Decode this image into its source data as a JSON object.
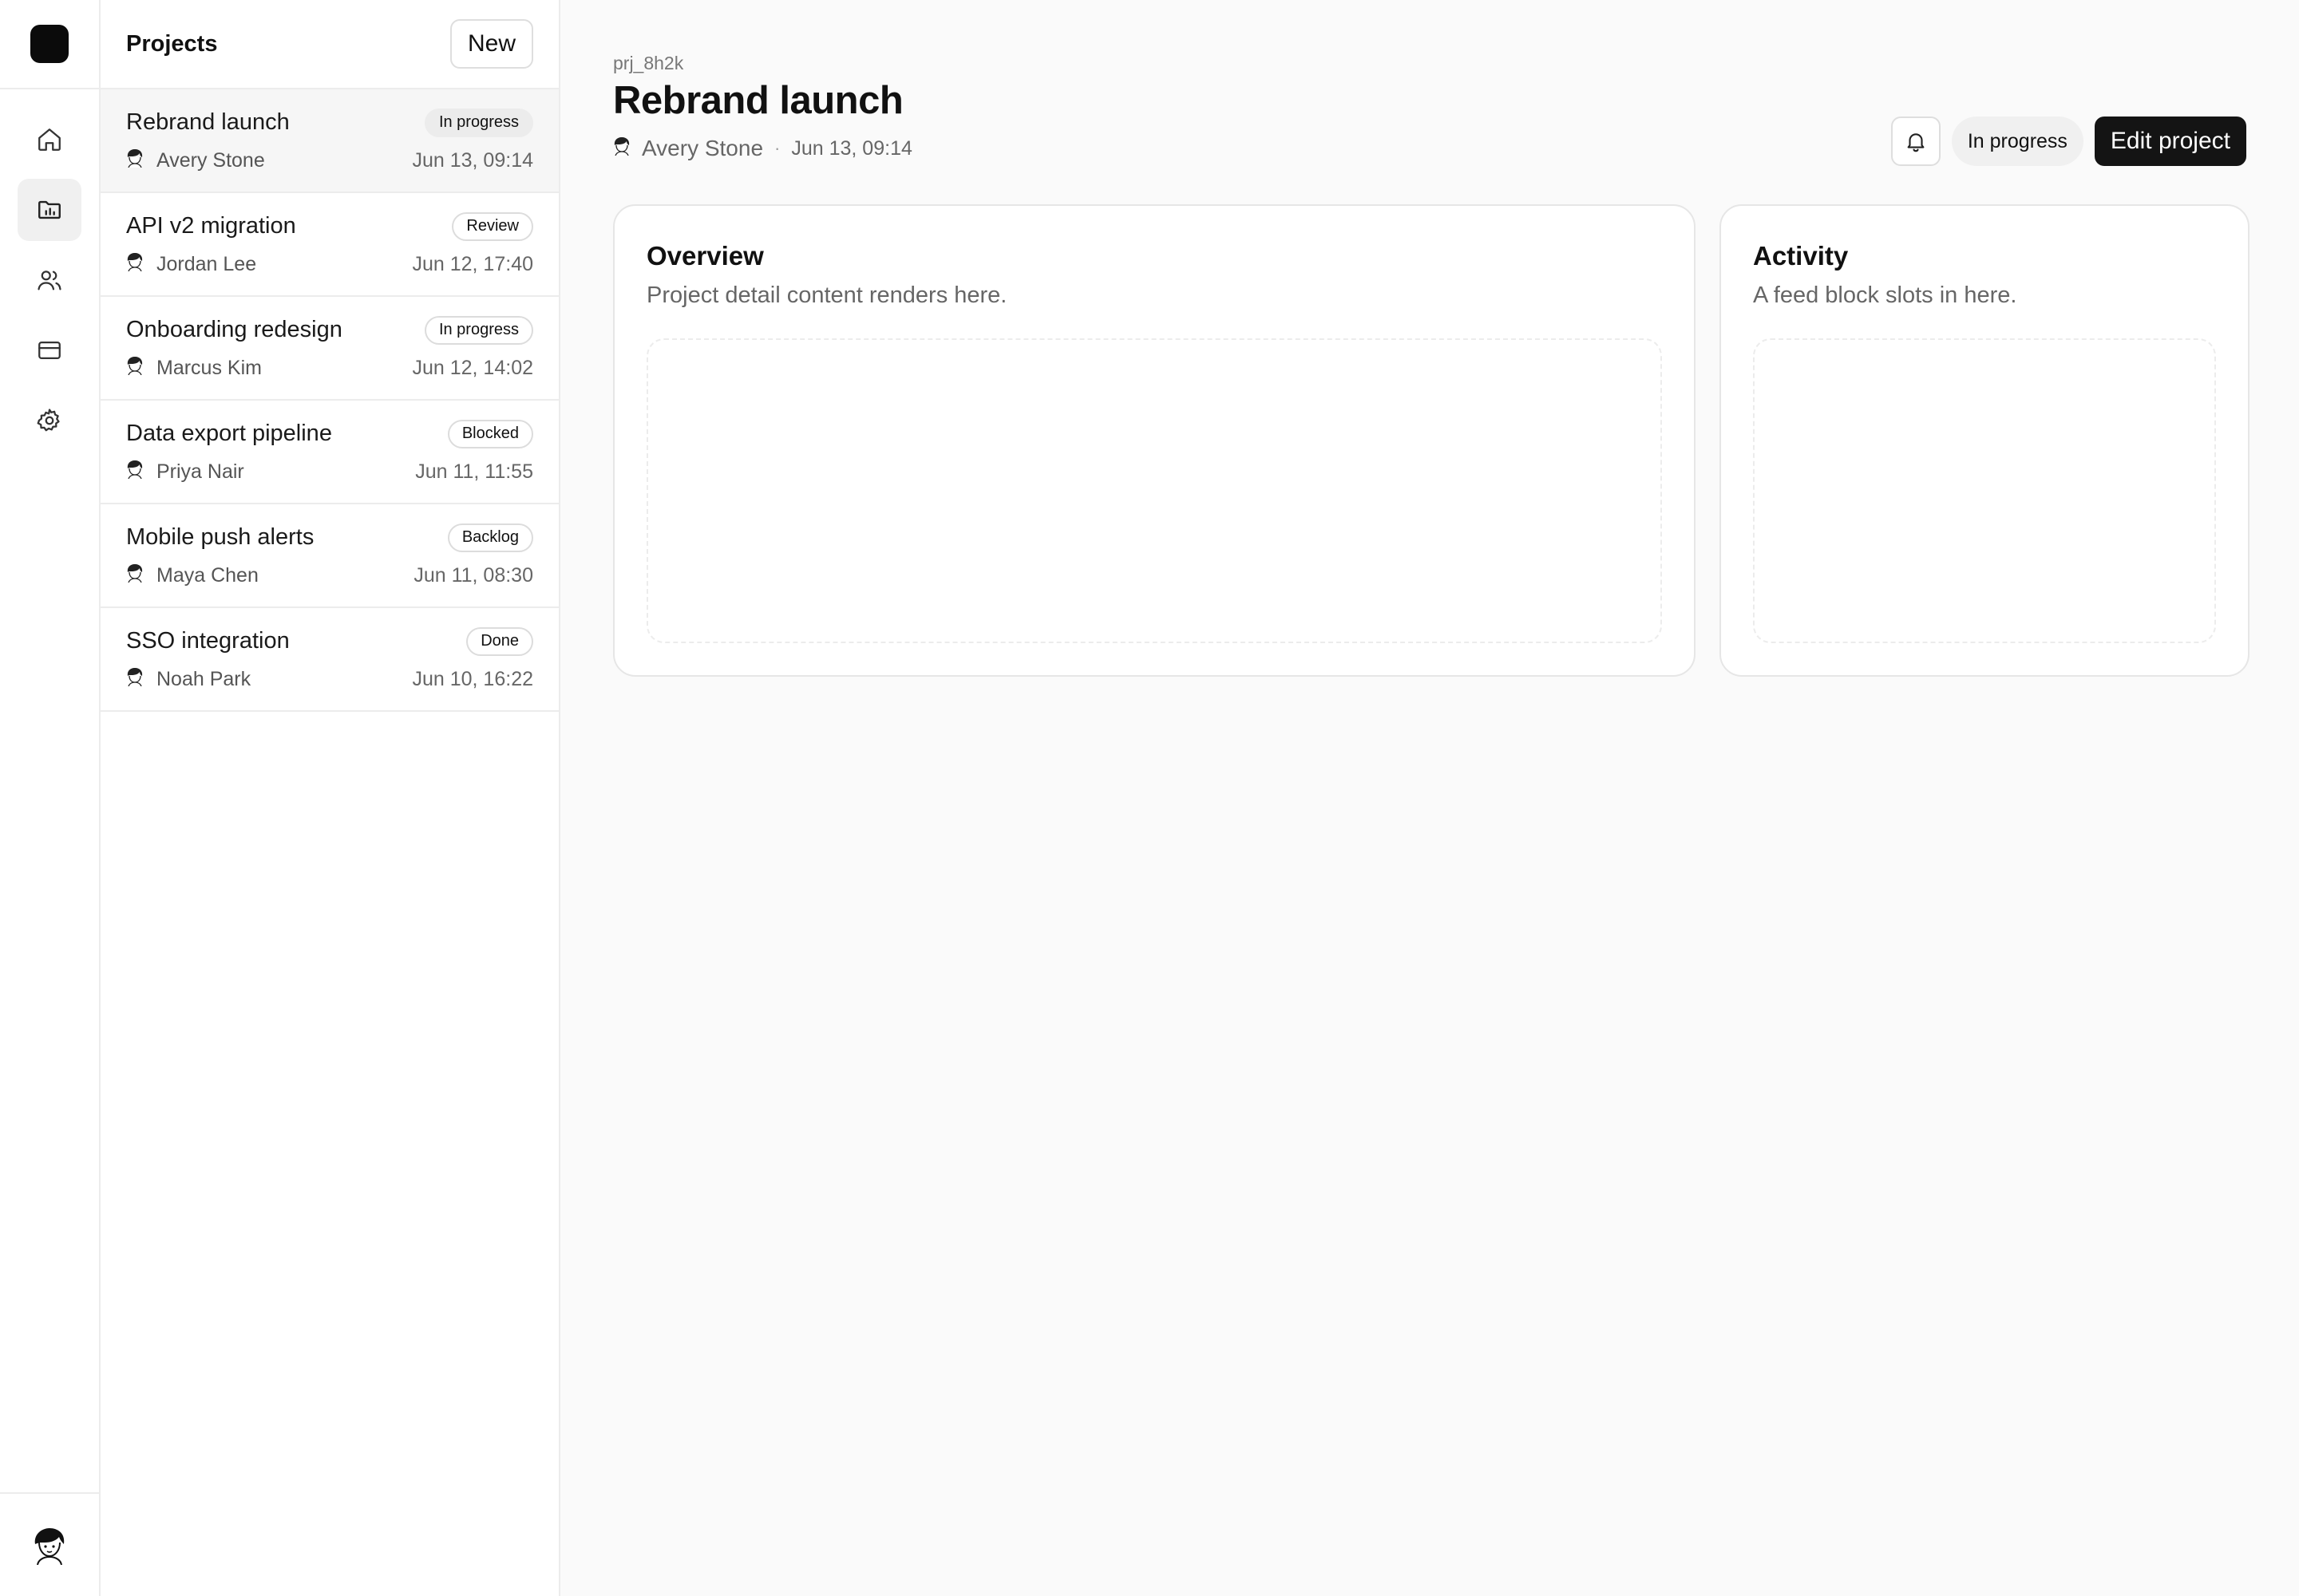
{
  "app": {
    "nav": [
      {
        "name": "home",
        "icon": "home-icon",
        "active": false
      },
      {
        "name": "projects",
        "icon": "folder-chart-icon",
        "active": true
      },
      {
        "name": "people",
        "icon": "users-icon",
        "active": false
      },
      {
        "name": "billing",
        "icon": "credit-card-icon",
        "active": false
      },
      {
        "name": "settings",
        "icon": "gear-icon",
        "active": false
      }
    ],
    "user_avatar_icon": "user-avatar-icon"
  },
  "list": {
    "title": "Projects",
    "new_label": "New",
    "items": [
      {
        "name": "Rebrand launch",
        "status": "In progress",
        "owner": "Avery Stone",
        "time": "Jun 13, 09:14",
        "selected": true
      },
      {
        "name": "API v2 migration",
        "status": "Review",
        "owner": "Jordan Lee",
        "time": "Jun 12, 17:40",
        "selected": false
      },
      {
        "name": "Onboarding redesign",
        "status": "In progress",
        "owner": "Marcus Kim",
        "time": "Jun 12, 14:02",
        "selected": false
      },
      {
        "name": "Data export pipeline",
        "status": "Blocked",
        "owner": "Priya Nair",
        "time": "Jun 11, 11:55",
        "selected": false
      },
      {
        "name": "Mobile push alerts",
        "status": "Backlog",
        "owner": "Maya Chen",
        "time": "Jun 11, 08:30",
        "selected": false
      },
      {
        "name": "SSO integration",
        "status": "Done",
        "owner": "Noah Park",
        "time": "Jun 10, 16:22",
        "selected": false
      }
    ]
  },
  "detail": {
    "id": "prj_8h2k",
    "title": "Rebrand launch",
    "owner": "Avery Stone",
    "separator": "·",
    "time": "Jun 13, 09:14",
    "status": "In progress",
    "edit_label": "Edit project",
    "overview": {
      "title": "Overview",
      "subtitle": "Project detail content renders here."
    },
    "activity": {
      "title": "Activity",
      "subtitle": "A feed block slots in here."
    }
  },
  "colors": {
    "accent": "#141414",
    "background": "#fafafa",
    "border": "#ececec"
  }
}
